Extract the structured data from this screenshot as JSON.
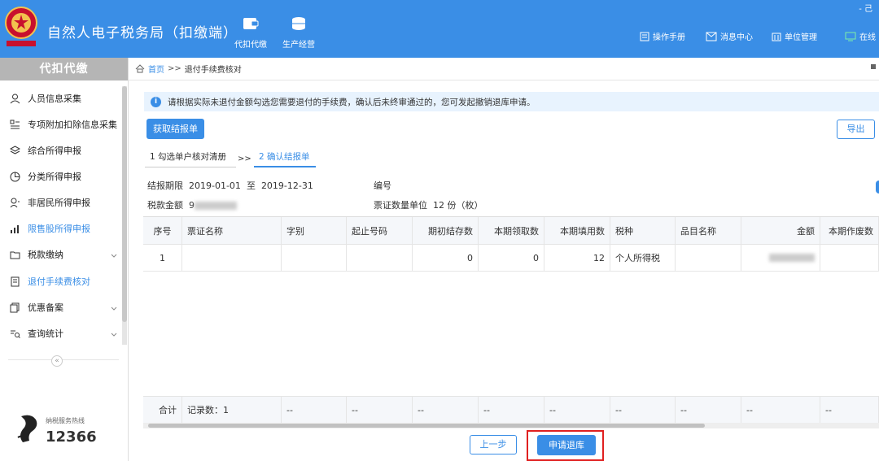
{
  "header": {
    "title": "自然人电子税务局（扣缴端）",
    "nav": [
      {
        "label": "代扣代缴",
        "icon": "wallet-icon"
      },
      {
        "label": "生产经营",
        "icon": "coins-icon"
      }
    ],
    "right_menu": [
      {
        "label": "操作手册",
        "icon": "book-icon"
      },
      {
        "label": "消息中心",
        "icon": "mail-icon"
      },
      {
        "label": "单位管理",
        "icon": "building-icon"
      },
      {
        "label": "在线",
        "icon": "monitor-icon"
      }
    ],
    "corner_text": "- 己"
  },
  "sidebar": {
    "title": "代扣代缴",
    "items": [
      {
        "label": "人员信息采集",
        "icon": "person-icon",
        "active": false,
        "has_chevron": false
      },
      {
        "label": "专项附加扣除信息采集",
        "icon": "list-icon",
        "active": false,
        "has_chevron": false
      },
      {
        "label": "综合所得申报",
        "icon": "layers-icon",
        "active": false,
        "has_chevron": false
      },
      {
        "label": "分类所得申报",
        "icon": "pie-icon",
        "active": false,
        "has_chevron": false
      },
      {
        "label": "非居民所得申报",
        "icon": "person-outline-icon",
        "active": false,
        "has_chevron": false
      },
      {
        "label": "限售股所得申报",
        "icon": "bar-chart-icon",
        "active": true,
        "has_chevron": false
      },
      {
        "label": "税款缴纳",
        "icon": "folder-icon",
        "active": false,
        "has_chevron": true
      },
      {
        "label": "退付手续费核对",
        "icon": "doc-icon",
        "active": true,
        "has_chevron": false
      },
      {
        "label": "优惠备案",
        "icon": "copy-icon",
        "active": false,
        "has_chevron": true
      },
      {
        "label": "查询统计",
        "icon": "search-list-icon",
        "active": false,
        "has_chevron": true
      }
    ],
    "collapse": "«",
    "hotline_label": "纳税服务热线",
    "hotline_number": "12366"
  },
  "breadcrumb": {
    "home": "首页",
    "sep": ">>",
    "current": "退付手续费核对"
  },
  "notice": "请根据实际未退付金额勾选您需要退付的手续费，确认后未终审通过的，您可发起撤销退库申请。",
  "buttons": {
    "fetch": "获取结报单",
    "export": "导出",
    "prev": "上一步",
    "apply": "申请退库"
  },
  "steps": {
    "step1": "1 勾选单户核对清册",
    "sep": ">>",
    "step2": "2 确认结报单"
  },
  "info": {
    "period_label": "结报期限",
    "period_start": "2019-01-01",
    "period_to": "至",
    "period_end": "2019-12-31",
    "number_label": "编号",
    "tax_amount_label": "税款金额",
    "tax_amount_value": "9",
    "ticket_unit_label": "票证数量单位",
    "ticket_unit_value": "12 份（枚）"
  },
  "table": {
    "columns": [
      "序号",
      "票证名称",
      "字别",
      "起止号码",
      "期初结存数",
      "本期领取数",
      "本期填用数",
      "税种",
      "品目名称",
      "金额",
      "本期作废数"
    ],
    "rows": [
      [
        "1",
        "",
        "",
        "",
        "0",
        "0",
        "12",
        "个人所得税",
        "",
        "",
        ""
      ]
    ],
    "footer": [
      "合计",
      "记录数：1",
      "--",
      "--",
      "--",
      "--",
      "--",
      "--",
      "--",
      "--",
      "--"
    ]
  }
}
